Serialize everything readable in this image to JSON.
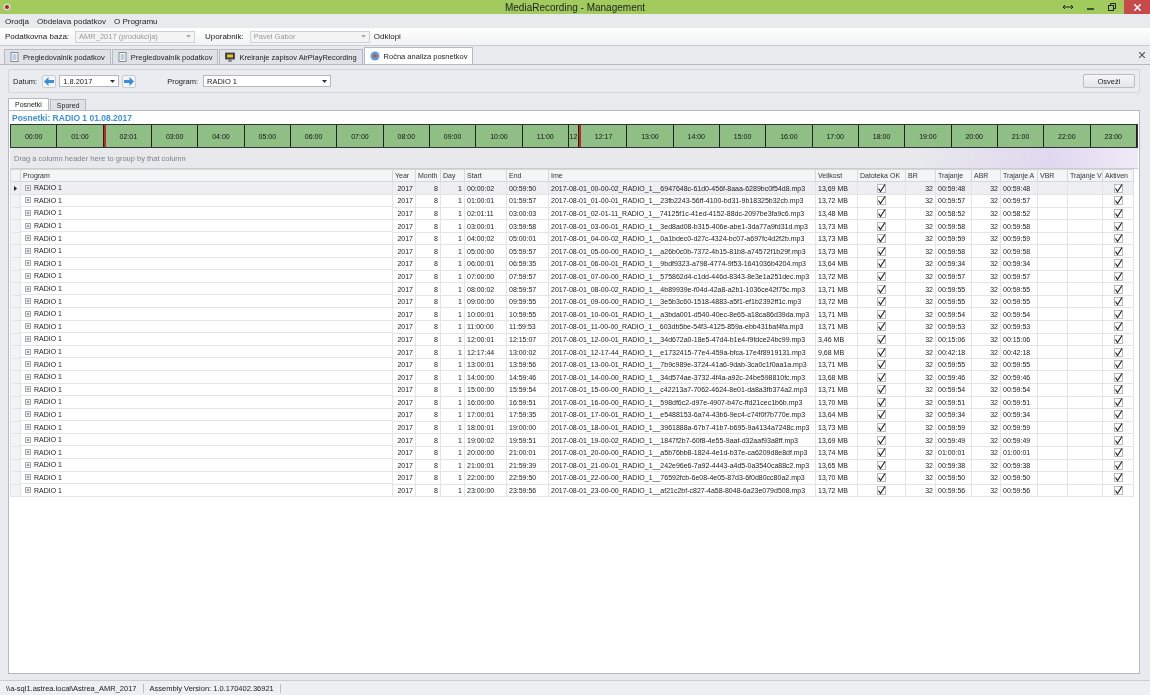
{
  "window": {
    "title": "MediaRecording - Management"
  },
  "menu": [
    "Orodja",
    "Obdelava podatkov",
    "O Programu"
  ],
  "toolbar": {
    "database_label": "Podatkovna baza:",
    "database": "AMR_2017 (produkcija)",
    "user_label": "Uporabnik:",
    "user": "Pavel Gabor",
    "disconnect": "Odklopi"
  },
  "tabs": [
    {
      "label": "Pregledovalnik podatkov",
      "kind": "document",
      "selected": false
    },
    {
      "label": "Pregledovalnik podatkov",
      "kind": "document",
      "selected": false
    },
    {
      "label": "Kreiranje zapisov AirPlayRecording",
      "kind": "monitor",
      "selected": false
    },
    {
      "label": "Ročna analiza posnetkov",
      "kind": "disc",
      "selected": true
    }
  ],
  "filter": {
    "date_label": "Datum:",
    "date": "1.8.2017",
    "program_label": "Program:",
    "program": "RADIO 1",
    "refresh": "Osveži"
  },
  "subtabs": [
    {
      "label": "Posnetki",
      "selected": true
    },
    {
      "label": "Spored",
      "selected": false
    }
  ],
  "caption": "Posnetki: RADIO 1 01.08.2017",
  "timeline": [
    {
      "label": "00:00",
      "kind": "hour",
      "marked": false
    },
    {
      "label": "01:00",
      "kind": "hour",
      "marked": false
    },
    {
      "label": "02:01",
      "kind": "hour",
      "marked": true
    },
    {
      "label": "03:00",
      "kind": "hour",
      "marked": false
    },
    {
      "label": "04:00",
      "kind": "hour",
      "marked": false
    },
    {
      "label": "05:00",
      "kind": "hour",
      "marked": false
    },
    {
      "label": "06:00",
      "kind": "hour",
      "marked": false
    },
    {
      "label": "07:00",
      "kind": "hour",
      "marked": false
    },
    {
      "label": "08:00",
      "kind": "hour",
      "marked": false
    },
    {
      "label": "09:00",
      "kind": "hour",
      "marked": false
    },
    {
      "label": "10:00",
      "kind": "hour",
      "marked": false
    },
    {
      "label": "11:00",
      "kind": "hour",
      "marked": false
    },
    {
      "label": "12",
      "kind": "short",
      "marked": false
    },
    {
      "label": "12:17",
      "kind": "hour",
      "marked": true
    },
    {
      "label": "13:00",
      "kind": "hour",
      "marked": false
    },
    {
      "label": "14:00",
      "kind": "hour",
      "marked": false
    },
    {
      "label": "15:00",
      "kind": "hour",
      "marked": false
    },
    {
      "label": "16:00",
      "kind": "hour",
      "marked": false
    },
    {
      "label": "17:00",
      "kind": "hour",
      "marked": false
    },
    {
      "label": "18:00",
      "kind": "hour",
      "marked": false
    },
    {
      "label": "19:00",
      "kind": "hour",
      "marked": false
    },
    {
      "label": "20:00",
      "kind": "hour",
      "marked": false
    },
    {
      "label": "21:00",
      "kind": "hour",
      "marked": false
    },
    {
      "label": "22:00",
      "kind": "hour",
      "marked": false
    },
    {
      "label": "23:00",
      "kind": "hour",
      "marked": false
    }
  ],
  "group_panel": {
    "placeholder": "Drag a column header here to group by that column"
  },
  "table": {
    "columns": [
      "Program",
      "Year",
      "Month",
      "Day",
      "Start",
      "End",
      "Ime",
      "Velikost",
      "Datoteka OK",
      "BR",
      "Trajanje",
      "ABR",
      "Trajanje A",
      "VBR",
      "Trajanje V",
      "Aktiven"
    ],
    "rows": [
      {
        "selected": true,
        "program": "RADIO 1",
        "year": "2017",
        "month": "8",
        "day": "1",
        "start": "00:00:02",
        "end": "00:59:50",
        "name": "2017-08-01_00-00-02_RADIO_1__6947648c-61d0-456f-8aaa-6289bc0f54d8.mp3",
        "size": "13,69 MB",
        "file_ok": true,
        "br": "32",
        "duration": "00:59:48",
        "abr": "32",
        "duration_a": "00:59:48",
        "active": true
      },
      {
        "selected": false,
        "program": "RADIO 1",
        "year": "2017",
        "month": "8",
        "day": "1",
        "start": "01:00:01",
        "end": "01:59:57",
        "name": "2017-08-01_01-00-01_RADIO_1__23fb2243-56ff-4100-bd31-9b18325b32cb.mp3",
        "size": "13,72 MB",
        "file_ok": true,
        "br": "32",
        "duration": "00:59:57",
        "abr": "32",
        "duration_a": "00:59:57",
        "active": true
      },
      {
        "selected": false,
        "program": "RADIO 1",
        "year": "2017",
        "month": "8",
        "day": "1",
        "start": "02:01:11",
        "end": "03:00:03",
        "name": "2017-08-01_02-01-11_RADIO_1__74125f1c-41ed-4152-88dc-2097be3fa9c6.mp3",
        "size": "13,48 MB",
        "file_ok": true,
        "br": "32",
        "duration": "00:58:52",
        "abr": "32",
        "duration_a": "00:58:52",
        "active": true
      },
      {
        "selected": false,
        "program": "RADIO 1",
        "year": "2017",
        "month": "8",
        "day": "1",
        "start": "03:00:01",
        "end": "03:59:58",
        "name": "2017-08-01_03-00-01_RADIO_1__3ed8ad08-b315-406e-abe1-3da77a9fd31d.mp3",
        "size": "13,73 MB",
        "file_ok": true,
        "br": "32",
        "duration": "00:59:58",
        "abr": "32",
        "duration_a": "00:59:58",
        "active": true
      },
      {
        "selected": false,
        "program": "RADIO 1",
        "year": "2017",
        "month": "8",
        "day": "1",
        "start": "04:00:02",
        "end": "05:00:01",
        "name": "2017-08-01_04-00-02_RADIO_1__0a1bdec0-d27c-4324-bc07-a697fc4d2f2b.mp3",
        "size": "13,73 MB",
        "file_ok": true,
        "br": "32",
        "duration": "00:59:59",
        "abr": "32",
        "duration_a": "00:59:59",
        "active": true
      },
      {
        "selected": false,
        "program": "RADIO 1",
        "year": "2017",
        "month": "8",
        "day": "1",
        "start": "05:00:00",
        "end": "05:59:57",
        "name": "2017-08-01_05-00-00_RADIO_1__a26b0c0b-7372-4b15-81b8-a74572f1b29f.mp3",
        "size": "13,73 MB",
        "file_ok": true,
        "br": "32",
        "duration": "00:59:58",
        "abr": "32",
        "duration_a": "00:59:58",
        "active": true
      },
      {
        "selected": false,
        "program": "RADIO 1",
        "year": "2017",
        "month": "8",
        "day": "1",
        "start": "06:00:01",
        "end": "06:59:35",
        "name": "2017-08-01_06-00-01_RADIO_1__9bdf9323-a798-4774-9f53-1641036b4204.mp3",
        "size": "13,64 MB",
        "file_ok": true,
        "br": "32",
        "duration": "00:59:34",
        "abr": "32",
        "duration_a": "00:59:34",
        "active": true
      },
      {
        "selected": false,
        "program": "RADIO 1",
        "year": "2017",
        "month": "8",
        "day": "1",
        "start": "07:00:00",
        "end": "07:59:57",
        "name": "2017-08-01_07-00-00_RADIO_1__575862d4-c1dd-446d-8343-8e3e1a251dec.mp3",
        "size": "13,72 MB",
        "file_ok": true,
        "br": "32",
        "duration": "00:59:57",
        "abr": "32",
        "duration_a": "00:59:57",
        "active": true
      },
      {
        "selected": false,
        "program": "RADIO 1",
        "year": "2017",
        "month": "8",
        "day": "1",
        "start": "08:00:02",
        "end": "08:59:57",
        "name": "2017-08-01_08-00-02_RADIO_1__4b89939e-f04d-42a8-a2b1-1036ce42f75c.mp3",
        "size": "13,71 MB",
        "file_ok": true,
        "br": "32",
        "duration": "00:59:55",
        "abr": "32",
        "duration_a": "00:59:55",
        "active": true
      },
      {
        "selected": false,
        "program": "RADIO 1",
        "year": "2017",
        "month": "8",
        "day": "1",
        "start": "09:00:00",
        "end": "09:59:55",
        "name": "2017-08-01_09-00-00_RADIO_1__3e5b3c60-1518-4883-a5f1-ef1b2392ff1c.mp3",
        "size": "13,72 MB",
        "file_ok": true,
        "br": "32",
        "duration": "00:59:55",
        "abr": "32",
        "duration_a": "00:59:55",
        "active": true
      },
      {
        "selected": false,
        "program": "RADIO 1",
        "year": "2017",
        "month": "8",
        "day": "1",
        "start": "10:00:01",
        "end": "10:59:55",
        "name": "2017-08-01_10-00-01_RADIO_1__a3bda001-d540-40ec-8e65-a18ca86d39da.mp3",
        "size": "13,71 MB",
        "file_ok": true,
        "br": "32",
        "duration": "00:59:54",
        "abr": "32",
        "duration_a": "00:59:54",
        "active": true
      },
      {
        "selected": false,
        "program": "RADIO 1",
        "year": "2017",
        "month": "8",
        "day": "1",
        "start": "11:00:00",
        "end": "11:59:53",
        "name": "2017-08-01_11-00-00_RADIO_1__603db5be-54f3-4125-859a-ebb431baf4fa.mp3",
        "size": "13,71 MB",
        "file_ok": true,
        "br": "32",
        "duration": "00:59:53",
        "abr": "32",
        "duration_a": "00:59:53",
        "active": true
      },
      {
        "selected": false,
        "program": "RADIO 1",
        "year": "2017",
        "month": "8",
        "day": "1",
        "start": "12:00:01",
        "end": "12:15:07",
        "name": "2017-08-01_12-00-01_RADIO_1__34d672a0-18e5-47d4-b1e4-f9fdce24bc99.mp3",
        "size": "3,46 MB",
        "file_ok": true,
        "br": "32",
        "duration": "00:15:06",
        "abr": "32",
        "duration_a": "00:15:06",
        "active": true
      },
      {
        "selected": false,
        "program": "RADIO 1",
        "year": "2017",
        "month": "8",
        "day": "1",
        "start": "12:17:44",
        "end": "13:00:02",
        "name": "2017-08-01_12-17-44_RADIO_1__e1732415-77e4-459a-bfca-17e4f8919131.mp3",
        "size": "9,68 MB",
        "file_ok": true,
        "br": "32",
        "duration": "00:42:18",
        "abr": "32",
        "duration_a": "00:42:18",
        "active": true
      },
      {
        "selected": false,
        "program": "RADIO 1",
        "year": "2017",
        "month": "8",
        "day": "1",
        "start": "13:00:01",
        "end": "13:59:56",
        "name": "2017-08-01_13-00-01_RADIO_1__7b9c989e-3724-41a6-9dab-3ca0c1f0aa1a.mp3",
        "size": "13,71 MB",
        "file_ok": true,
        "br": "32",
        "duration": "00:59:55",
        "abr": "32",
        "duration_a": "00:59:55",
        "active": true
      },
      {
        "selected": false,
        "program": "RADIO 1",
        "year": "2017",
        "month": "8",
        "day": "1",
        "start": "14:00:00",
        "end": "14:59:46",
        "name": "2017-08-01_14-00-00_RADIO_1__34d574ae-3732-4f4a-a92c-24be598810fc.mp3",
        "size": "13,68 MB",
        "file_ok": true,
        "br": "32",
        "duration": "00:59:46",
        "abr": "32",
        "duration_a": "00:59:46",
        "active": true
      },
      {
        "selected": false,
        "program": "RADIO 1",
        "year": "2017",
        "month": "8",
        "day": "1",
        "start": "15:00:00",
        "end": "15:59:54",
        "name": "2017-08-01_15-00-00_RADIO_1__c42213a7-7062-4624-8e01-da8a3fb374a2.mp3",
        "size": "13,71 MB",
        "file_ok": true,
        "br": "32",
        "duration": "00:59:54",
        "abr": "32",
        "duration_a": "00:59:54",
        "active": true
      },
      {
        "selected": false,
        "program": "RADIO 1",
        "year": "2017",
        "month": "8",
        "day": "1",
        "start": "16:00:00",
        "end": "16:59:51",
        "name": "2017-08-01_16-00-00_RADIO_1__598df6c2-d97e-4907-b47c-ffd21cec1b6b.mp3",
        "size": "13,70 MB",
        "file_ok": true,
        "br": "32",
        "duration": "00:59:51",
        "abr": "32",
        "duration_a": "00:59:51",
        "active": true
      },
      {
        "selected": false,
        "program": "RADIO 1",
        "year": "2017",
        "month": "8",
        "day": "1",
        "start": "17:00:01",
        "end": "17:59:35",
        "name": "2017-08-01_17-00-01_RADIO_1__e5488153-6a74-43b6-9ec4-c74f0f7b770e.mp3",
        "size": "13,64 MB",
        "file_ok": true,
        "br": "32",
        "duration": "00:59:34",
        "abr": "32",
        "duration_a": "00:59:34",
        "active": true
      },
      {
        "selected": false,
        "program": "RADIO 1",
        "year": "2017",
        "month": "8",
        "day": "1",
        "start": "18:00:01",
        "end": "19:00:00",
        "name": "2017-08-01_18-00-01_RADIO_1__3961888a-67b7-41b7-b695-9a4134a7248c.mp3",
        "size": "13,73 MB",
        "file_ok": true,
        "br": "32",
        "duration": "00:59:59",
        "abr": "32",
        "duration_a": "00:59:59",
        "active": true
      },
      {
        "selected": false,
        "program": "RADIO 1",
        "year": "2017",
        "month": "8",
        "day": "1",
        "start": "19:00:02",
        "end": "19:59:51",
        "name": "2017-08-01_19-00-02_RADIO_1__1847f2b7-60f8-4e55-9aaf-d32aaf93a8ff.mp3",
        "size": "13,69 MB",
        "file_ok": true,
        "br": "32",
        "duration": "00:59:49",
        "abr": "32",
        "duration_a": "00:59:49",
        "active": true
      },
      {
        "selected": false,
        "program": "RADIO 1",
        "year": "2017",
        "month": "8",
        "day": "1",
        "start": "20:00:00",
        "end": "21:00:01",
        "name": "2017-08-01_20-00-00_RADIO_1__a5b76bb8-1824-4e1d-b37e-ca6209d8e8df.mp3",
        "size": "13,74 MB",
        "file_ok": true,
        "br": "32",
        "duration": "01:00:01",
        "abr": "32",
        "duration_a": "01:00:01",
        "active": true
      },
      {
        "selected": false,
        "program": "RADIO 1",
        "year": "2017",
        "month": "8",
        "day": "1",
        "start": "21:00:01",
        "end": "21:59:39",
        "name": "2017-08-01_21-00-01_RADIO_1__242e96e6-7a92-4443-a4d5-0a3540ca88c2.mp3",
        "size": "13,65 MB",
        "file_ok": true,
        "br": "32",
        "duration": "00:59:38",
        "abr": "32",
        "duration_a": "00:59:38",
        "active": true
      },
      {
        "selected": false,
        "program": "RADIO 1",
        "year": "2017",
        "month": "8",
        "day": "1",
        "start": "22:00:00",
        "end": "22:59:50",
        "name": "2017-08-01_22-00-00_RADIO_1__76592fcb-6e08-4e05-87d3-6f0d80cc80a2.mp3",
        "size": "13,70 MB",
        "file_ok": true,
        "br": "32",
        "duration": "00:59:50",
        "abr": "32",
        "duration_a": "00:59:50",
        "active": true
      },
      {
        "selected": false,
        "program": "RADIO 1",
        "year": "2017",
        "month": "8",
        "day": "1",
        "start": "23:00:00",
        "end": "23:59:56",
        "name": "2017-08-01_23-00-00_RADIO_1__af21c2bf-c827-4a58-8048-6a23e079d508.mp3",
        "size": "13,72 MB",
        "file_ok": true,
        "br": "32",
        "duration": "00:59:56",
        "abr": "32",
        "duration_a": "00:59:56",
        "active": true
      }
    ]
  },
  "status_bar": [
    "\\\\a-sql1.astrea.local\\Astrea_AMR_2017",
    "Assembly Version: 1.0.170402.36921"
  ]
}
